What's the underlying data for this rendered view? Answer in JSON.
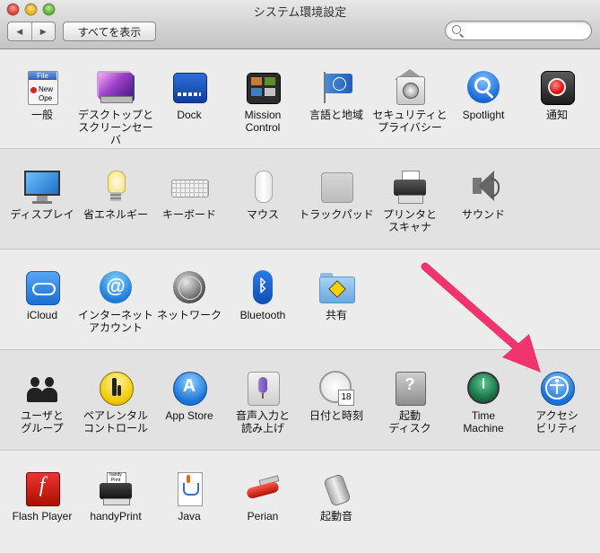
{
  "window": {
    "title": "システム環境設定"
  },
  "toolbar": {
    "back_label": "◀",
    "forward_label": "▶",
    "show_all_label": "すべてを表示",
    "search_placeholder": "",
    "search_value": ""
  },
  "rows": [
    [
      {
        "icon": "general-icon",
        "label": "一般",
        "icon_text": "File",
        "doc_text_1": "New",
        "doc_text_2": "Ope"
      },
      {
        "icon": "desktop-screensaver-icon",
        "label": "デスクトップと\nスクリーンセーバ"
      },
      {
        "icon": "dock-icon",
        "label": "Dock"
      },
      {
        "icon": "mission-control-icon",
        "label": "Mission\nControl"
      },
      {
        "icon": "language-region-icon",
        "label": "言語と地域"
      },
      {
        "icon": "security-privacy-icon",
        "label": "セキュリティと\nプライバシー"
      },
      {
        "icon": "spotlight-icon",
        "label": "Spotlight"
      },
      {
        "icon": "notifications-icon",
        "label": "通知"
      }
    ],
    [
      {
        "icon": "displays-icon",
        "label": "ディスプレイ"
      },
      {
        "icon": "energy-saver-icon",
        "label": "省エネルギー"
      },
      {
        "icon": "keyboard-icon",
        "label": "キーボード"
      },
      {
        "icon": "mouse-icon",
        "label": "マウス"
      },
      {
        "icon": "trackpad-icon",
        "label": "トラックパッド"
      },
      {
        "icon": "printers-scanners-icon",
        "label": "プリンタと\nスキャナ"
      },
      {
        "icon": "sound-icon",
        "label": "サウンド"
      }
    ],
    [
      {
        "icon": "icloud-icon",
        "label": "iCloud"
      },
      {
        "icon": "internet-accounts-icon",
        "label": "インターネット\nアカウント",
        "icon_text": "@"
      },
      {
        "icon": "network-icon",
        "label": "ネットワーク"
      },
      {
        "icon": "bluetooth-icon",
        "label": "Bluetooth",
        "icon_text": "ᛒ"
      },
      {
        "icon": "sharing-icon",
        "label": "共有"
      }
    ],
    [
      {
        "icon": "users-groups-icon",
        "label": "ユーザと\nグループ"
      },
      {
        "icon": "parental-controls-icon",
        "label": "ペアレンタル\nコントロール"
      },
      {
        "icon": "app-store-icon",
        "label": "App Store",
        "icon_text": "A"
      },
      {
        "icon": "dictation-speech-icon",
        "label": "音声入力と\n読み上げ"
      },
      {
        "icon": "date-time-icon",
        "label": "日付と時刻",
        "icon_text": "18"
      },
      {
        "icon": "startup-disk-icon",
        "label": "起動\nディスク",
        "icon_text": "?"
      },
      {
        "icon": "time-machine-icon",
        "label": "Time\nMachine"
      },
      {
        "icon": "accessibility-icon",
        "label": "アクセシ\nビリティ"
      }
    ],
    [
      {
        "icon": "flash-player-icon",
        "label": "Flash Player",
        "icon_text": "f"
      },
      {
        "icon": "handyprint-icon",
        "label": "handyPrint",
        "icon_text": "handy\nPrint"
      },
      {
        "icon": "java-icon",
        "label": "Java"
      },
      {
        "icon": "perian-icon",
        "label": "Perian"
      },
      {
        "icon": "startup-sound-icon",
        "label": "起動音"
      }
    ]
  ],
  "annotation": {
    "arrow_color": "#f0356e",
    "target": "アクセシビリティ"
  },
  "colors": {
    "accent": "#1a6fd6"
  }
}
